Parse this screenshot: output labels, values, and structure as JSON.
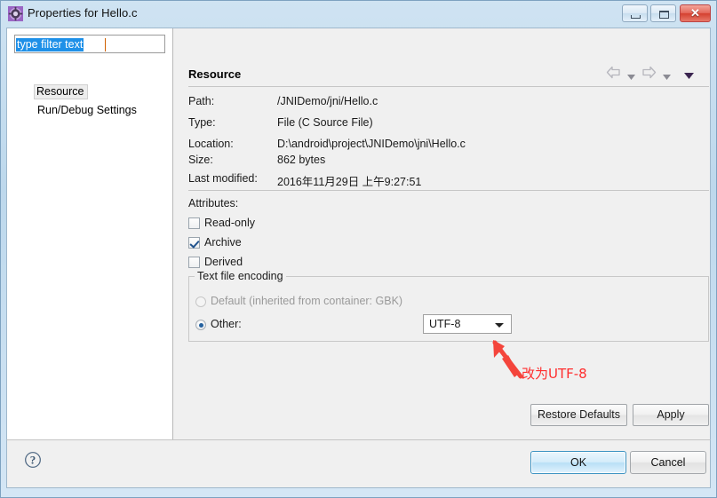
{
  "window": {
    "title": "Properties for Hello.c",
    "icon": "eclipse-gear-icon",
    "controls": {
      "minimize": "minimize-icon",
      "maximize": "maximize-icon",
      "close": "✕"
    }
  },
  "sidebar": {
    "filter": {
      "value": "type filter text",
      "placeholder": "type filter text",
      "selected": true
    },
    "items": [
      {
        "label": "Resource",
        "selected": true
      },
      {
        "label": "Run/Debug Settings",
        "selected": false
      }
    ]
  },
  "main": {
    "title": "Resource",
    "nav": {
      "back": "back-arrow-icon",
      "back_menu": "chevron-down-icon",
      "forward": "forward-arrow-icon",
      "forward_menu": "chevron-down-icon",
      "view_menu": "chevron-down-icon"
    },
    "info_rows": [
      {
        "label": "Path:",
        "value": "/JNIDemo/jni/Hello.c"
      },
      {
        "label": "Type:",
        "value": "File  (C Source File)"
      },
      {
        "label": "Location:",
        "value": "D:\\android\\project\\JNIDemo\\jni\\Hello.c"
      },
      {
        "label": "Size:",
        "value": "862  bytes"
      },
      {
        "label": "Last modified:",
        "value": "2016年11月29日 上午9:27:51"
      }
    ],
    "attributes": {
      "label": "Attributes:",
      "checkboxes": [
        {
          "label": "Read-only",
          "checked": false
        },
        {
          "label": "Archive",
          "checked": true
        },
        {
          "label": "Derived",
          "checked": false
        }
      ]
    },
    "encoding": {
      "legend": "Text file encoding",
      "options": [
        {
          "label": "Default (inherited from container: GBK)",
          "selected": false,
          "disabled": true
        },
        {
          "label": "Other:",
          "selected": true,
          "disabled": false
        }
      ],
      "select": {
        "value": "UTF-8",
        "arrow": "chevron-down-icon"
      }
    },
    "annotation": {
      "text": "改为UTF-8",
      "color": "#ff2d2d",
      "arrow": "red-pointer-arrow-icon"
    },
    "page_buttons": {
      "restore_defaults": "Restore Defaults",
      "apply": "Apply"
    }
  },
  "footer": {
    "help": "?",
    "ok": "OK",
    "cancel": "Cancel"
  }
}
